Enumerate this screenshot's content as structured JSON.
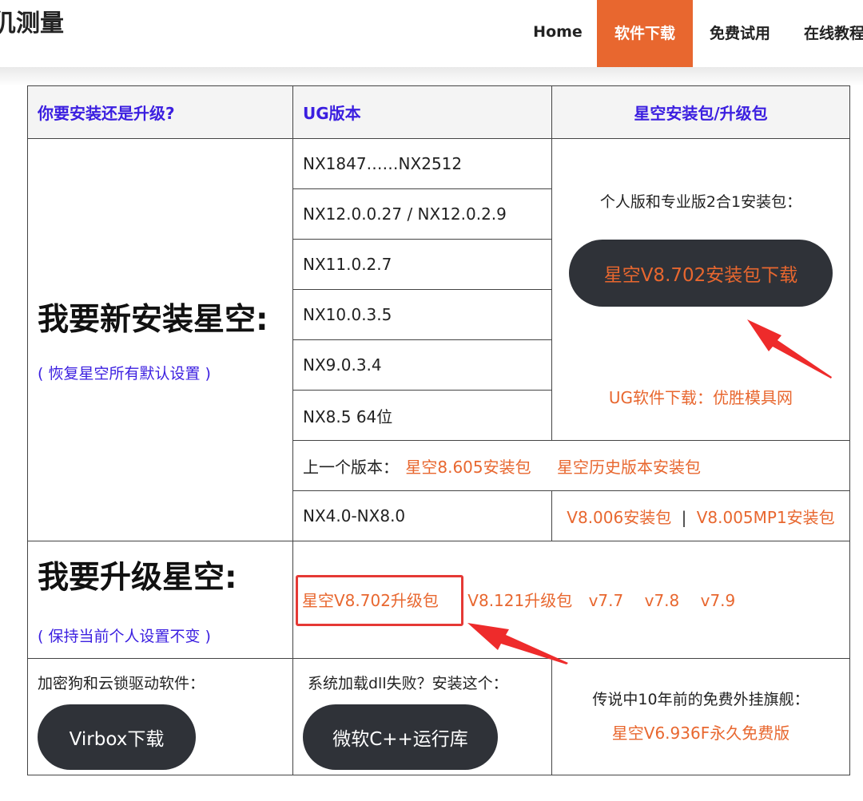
{
  "header": {
    "site_title": "仉测量",
    "nav": [
      "Home",
      "软件下载",
      "免费试用",
      "在线教程"
    ],
    "active_nav": "软件下载"
  },
  "table": {
    "headers": [
      "你要安装还是升级?",
      "UG版本",
      "星空安装包/升级包"
    ],
    "install": {
      "title": "我要新安装星空:",
      "note": "( 恢复星空所有默认设置 )",
      "versions": [
        "NX1847……NX2512",
        "NX12.0.0.27 / NX12.0.2.9",
        "NX11.0.2.7",
        "NX10.0.3.5",
        "NX9.0.3.4",
        "NX8.5  64位"
      ],
      "package_caption": "个人版和专业版2合1安装包：",
      "package_button": "星空V8.702安装包下载",
      "ug_download": "UG软件下载：优胜模具网",
      "prev_label": "上一个版本：",
      "prev_links": [
        "星空8.605安装包",
        "星空历史版本安装包"
      ],
      "old_version": "NX4.0-NX8.0",
      "old_links": [
        "V8.006安装包",
        "V8.005MP1安装包"
      ],
      "separator": "|"
    },
    "upgrade": {
      "title": "我要升级星空:",
      "note": "( 保持当前个人设置不变 )",
      "links": [
        "星空V8.702升级包",
        "V8.121升级包",
        "v7.7",
        "v7.8",
        "v7.9"
      ]
    },
    "footer": {
      "dongle_caption": "加密狗和云锁驱动软件：",
      "dongle_button": "Virbox下载",
      "dll_caption": "系统加载dll失败？安装这个：",
      "dll_button": "微软C++运行库",
      "legend_caption": "传说中10年前的免费外挂旗舰：",
      "legend_link": "星空V6.936F永久免费版"
    }
  },
  "colors": {
    "accent": "#e8672f",
    "header_text": "#3b1fe0",
    "button_bg": "#2f3238",
    "highlight": "#e53935"
  }
}
